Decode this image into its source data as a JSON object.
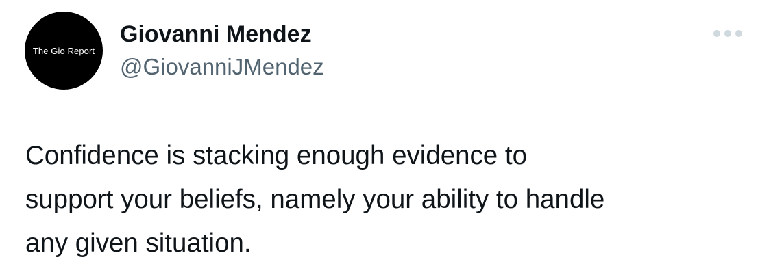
{
  "author": {
    "avatar_text": "The Gio Report",
    "display_name": "Giovanni Mendez",
    "handle": "@GiovanniJMendez"
  },
  "tweet": {
    "text": "Confidence is stacking enough evidence to\nsupport your beliefs, namely your ability to handle\nany given situation."
  },
  "icons": {
    "more": "more-horizontal-icon"
  },
  "colors": {
    "text_primary": "#0f1419",
    "text_secondary": "#536471",
    "icon_gray": "#cfd9de",
    "avatar_bg": "#000000",
    "background": "#ffffff"
  }
}
